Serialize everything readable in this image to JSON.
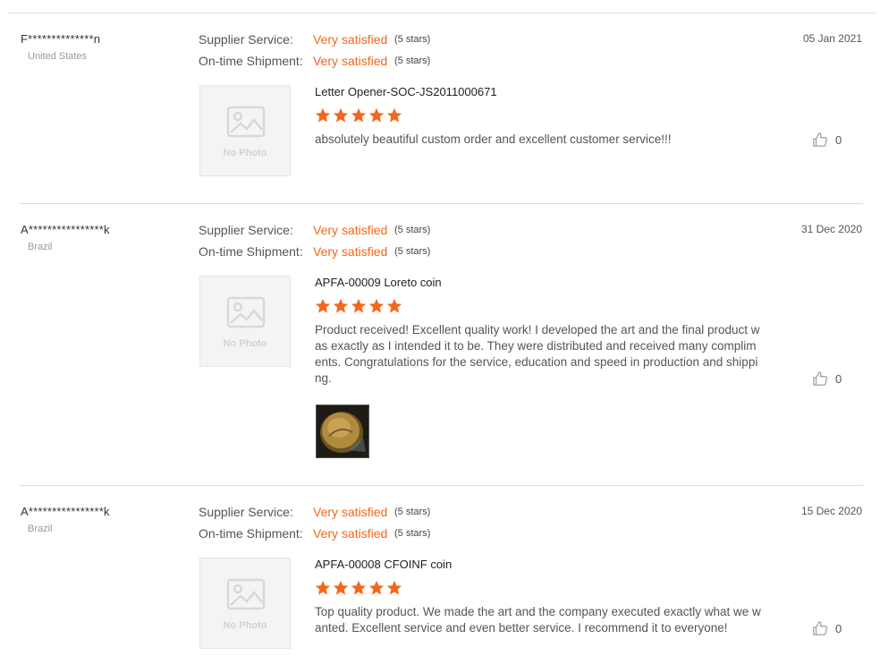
{
  "colors": {
    "accent": "#f4661b",
    "star": "#f4661b"
  },
  "reviews": [
    {
      "buyer": "F**************n",
      "country": "United States",
      "date": "05 Jan 2021",
      "supplier_service": {
        "label": "Supplier Service:",
        "value": "Very satisfied",
        "note": "(5 stars)"
      },
      "shipment": {
        "label": "On-time Shipment:",
        "value": "Very satisfied",
        "note": "(5 stars)"
      },
      "photo_placeholder": "No Photo",
      "product": "Letter Opener-SOC-JS2011000671",
      "rating": 5,
      "comment": "absolutely beautiful custom order and excellent customer service!!!",
      "likes": "0"
    },
    {
      "buyer": "A****************k",
      "country": "Brazil",
      "date": "31 Dec 2020",
      "supplier_service": {
        "label": "Supplier Service:",
        "value": "Very satisfied",
        "note": "(5 stars)"
      },
      "shipment": {
        "label": "On-time Shipment:",
        "value": "Very satisfied",
        "note": "(5 stars)"
      },
      "photo_placeholder": "No Photo",
      "product": "APFA-00009 Loreto coin",
      "rating": 5,
      "comment": "Product received! Excellent quality work! I developed the art and the final product was exactly as I intended it to be. They were distributed and received many compliments. Congratulations for the service, education and speed in production and shipping.",
      "likes": "0"
    },
    {
      "buyer": "A****************k",
      "country": "Brazil",
      "date": "15 Dec 2020",
      "supplier_service": {
        "label": "Supplier Service:",
        "value": "Very satisfied",
        "note": "(5 stars)"
      },
      "shipment": {
        "label": "On-time Shipment:",
        "value": "Very satisfied",
        "note": "(5 stars)"
      },
      "photo_placeholder": "No Photo",
      "product": "APFA-00008 CFOINF coin",
      "rating": 5,
      "comment": "Top quality product. We made the art and the company executed exactly what we wanted. Excellent service and even better service. I recommend it to everyone!",
      "likes": "0"
    }
  ]
}
